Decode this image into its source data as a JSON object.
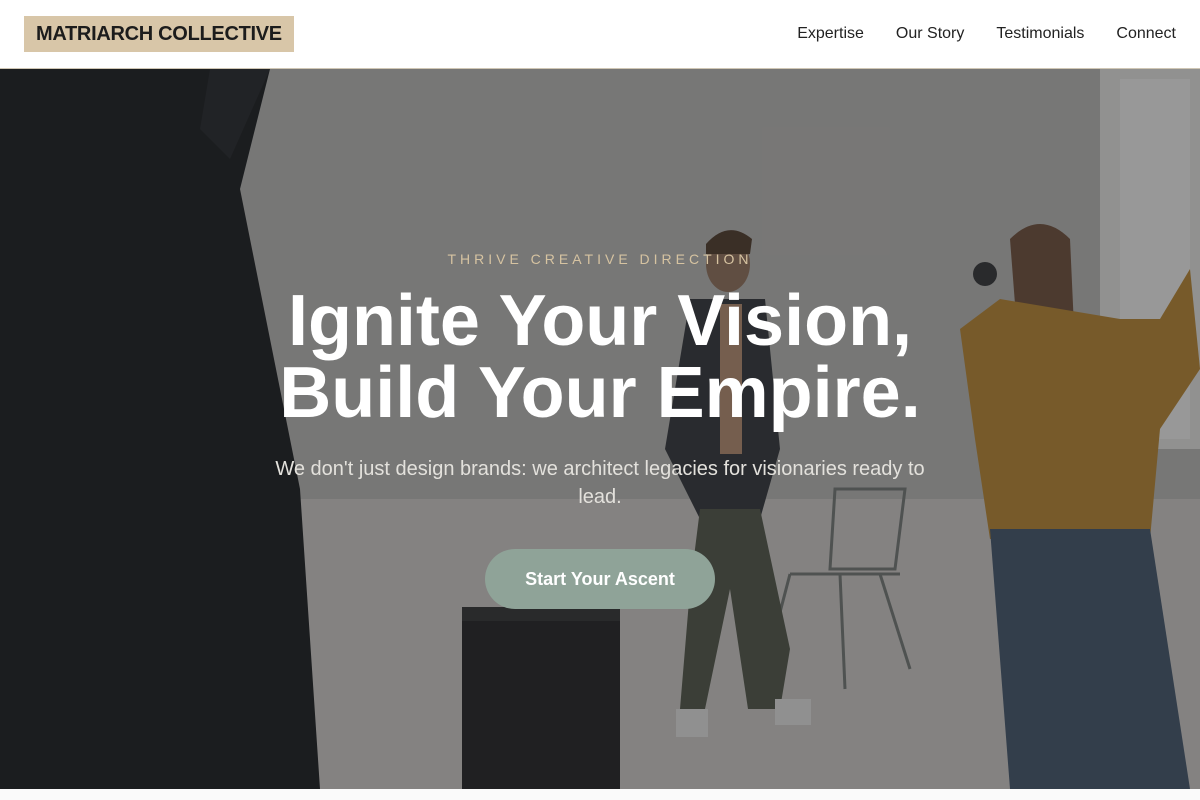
{
  "brand": {
    "name": "MATRIARCH COLLECTIVE"
  },
  "nav": {
    "items": [
      {
        "label": "Expertise"
      },
      {
        "label": "Our Story"
      },
      {
        "label": "Testimonials"
      },
      {
        "label": "Connect"
      }
    ]
  },
  "hero": {
    "eyebrow": "THRIVE CREATIVE DIRECTION",
    "headline_line1": "Ignite Your Vision,",
    "headline_line2": "Build Your Empire.",
    "subtext": "We don't just design brands: we architect legacies for visionaries ready to lead.",
    "cta_label": "Start Your Ascent",
    "background_image": "photo-studio-scene-photographer-and-model"
  },
  "colors": {
    "brand_badge": "#d8c6a8",
    "eyebrow": "#d6c3a1",
    "cta": "#8fa398",
    "header_border": "#cfc6b4"
  }
}
